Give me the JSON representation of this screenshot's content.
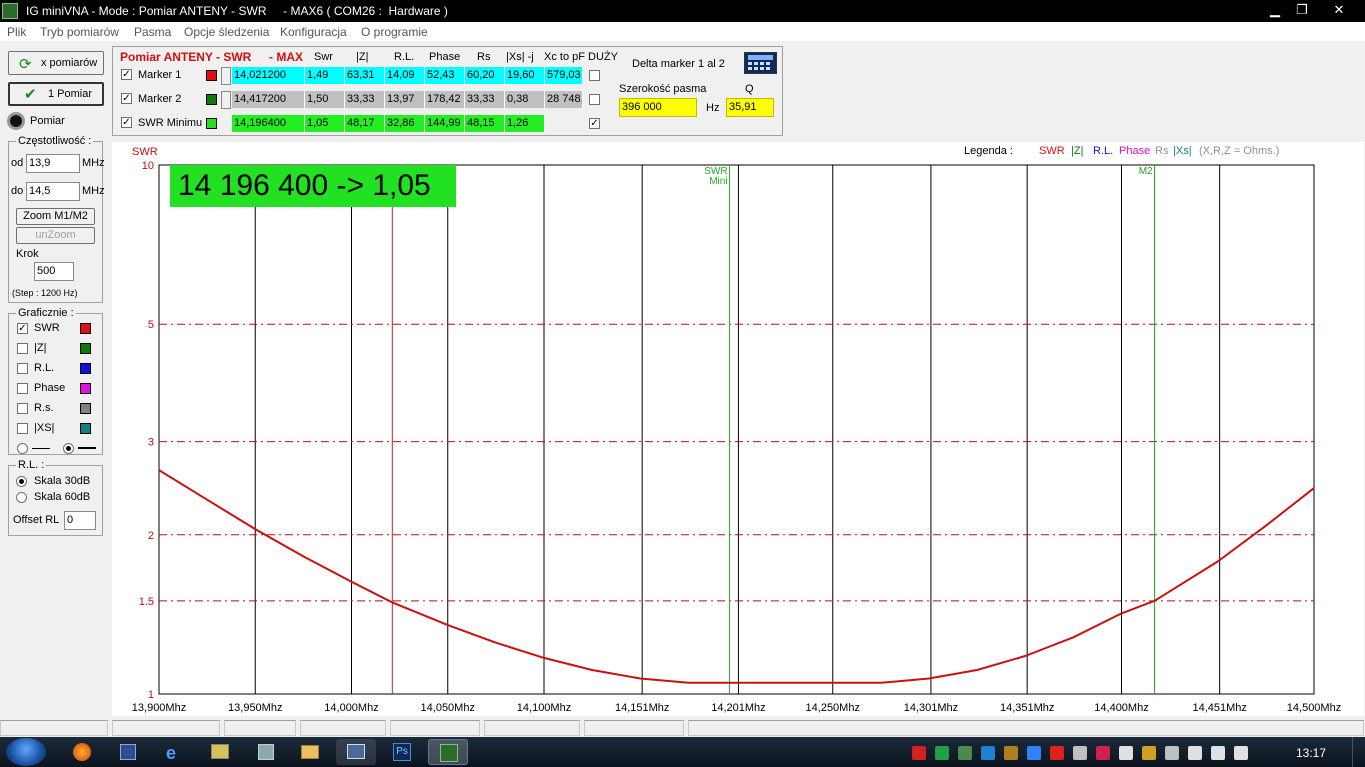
{
  "window": {
    "title": "IG miniVNA - Mode : Pomiar ANTENY - SWR     - MAX6 ( COM26 :  Hardware )",
    "minimize": "▁",
    "maximize": "❐",
    "close": "✕"
  },
  "menu": [
    "Plik",
    "Tryb pomiarów",
    "Pasma",
    "Opcje śledzenia",
    "Konfiguracja",
    "O programie"
  ],
  "left": {
    "x_pomiarow": "x pomiarów",
    "one_pomiar": "1 Pomiar",
    "pomiar": "Pomiar",
    "freq_group": "Częstotliwość :",
    "od_label": "od",
    "od_value": "13,9",
    "do_label": "do",
    "do_value": "14,5",
    "mhz": "MHz",
    "zoom": "Zoom M1/M2",
    "unzoom": "unZoom",
    "krok_label": "Krok",
    "krok_value": "500",
    "step": "(Step : 1200 Hz)",
    "graf_group": "Graficznie :",
    "graf_items": [
      {
        "label": "SWR",
        "checked": "✓",
        "color": "#e01010"
      },
      {
        "label": "|Z|",
        "checked": "",
        "color": "#0a7a0a"
      },
      {
        "label": "R.L.",
        "checked": "",
        "color": "#1010e0"
      },
      {
        "label": "Phase",
        "checked": "",
        "color": "#e010e0"
      },
      {
        "label": "R.s.",
        "checked": "",
        "color": "#808080"
      },
      {
        "label": "|XS|",
        "checked": "",
        "color": "#108080"
      }
    ],
    "rl_group": "R.L. :",
    "skala30": "Skala 30dB",
    "skala60": "Skala 60dB",
    "offset_label": "Offset RL",
    "offset_value": "0"
  },
  "markers": {
    "title_left": "Pomiar ANTENY - SWR",
    "title_right": "- MAX",
    "headers": [
      "Swr",
      "|Z|",
      "R.L.",
      "Phase",
      "Rs",
      "|Xs| -j",
      "Xc to pF",
      "DUŻY"
    ],
    "rows": [
      {
        "label": "Marker 1",
        "check": "✓",
        "color": "#e01010",
        "freq": "14,021200",
        "swr": "1,49",
        "z": "63,31",
        "rl": "14,09",
        "phase": "52,43",
        "rs": "60,20",
        "xs": "19,60",
        "xc": "579,03",
        "duzy": ""
      },
      {
        "label": "Marker 2",
        "check": "✓",
        "color": "#0a7a0a",
        "freq": "14,417200",
        "swr": "1,50",
        "z": "33,33",
        "rl": "13,97",
        "phase": "178,42",
        "rs": "33,33",
        "xs": "0,38",
        "xc": "28 748,",
        "duzy": ""
      },
      {
        "label": "SWR Minimu",
        "check": "✓",
        "color": "#22dd22",
        "freq": "14,196400",
        "swr": "1,05",
        "z": "48,17",
        "rl": "32,86",
        "phase": "144,99",
        "rs": "48,15",
        "xs": "1,26",
        "xc": "",
        "duzy": "✓"
      }
    ],
    "delta_label": "Delta marker 1 al 2",
    "bandwidth_label": "Szerokość pasma",
    "q_label": "Q",
    "bandwidth_value": "396 000",
    "hz": "Hz",
    "q_value": "35,91"
  },
  "chart_data": {
    "type": "line",
    "title": "SWR",
    "big_readout": "14 196 400 -> 1,05",
    "legend_label": "Legenda :",
    "legend_items": [
      {
        "name": "SWR",
        "color": "#e01010"
      },
      {
        "name": "|Z|",
        "color": "#0a7a0a"
      },
      {
        "name": "R.L.",
        "color": "#1010c0"
      },
      {
        "name": "Phase",
        "color": "#d010d0"
      },
      {
        "name": "Rs",
        "color": "#909090"
      },
      {
        "name": "|Xs|",
        "color": "#108080"
      },
      {
        "name": "(X,R,Z = Ohms.)",
        "color": "#909090"
      }
    ],
    "x_range": [
      13.9,
      14.5
    ],
    "y_scale": "log",
    "ylim": [
      1,
      10
    ],
    "y_ticks": [
      {
        "value": 10,
        "label": "10"
      },
      {
        "value": 5,
        "label": "5"
      },
      {
        "value": 3,
        "label": "3"
      },
      {
        "value": 2,
        "label": "2"
      },
      {
        "value": 1.5,
        "label": "1.5"
      },
      {
        "value": 1,
        "label": "1"
      }
    ],
    "x_ticks": [
      {
        "value": 13.9,
        "label": "13,900Mhz"
      },
      {
        "value": 13.95,
        "label": "13,950Mhz"
      },
      {
        "value": 14.0,
        "label": "14,000Mhz"
      },
      {
        "value": 14.05,
        "label": "14,050Mhz"
      },
      {
        "value": 14.1,
        "label": "14,100Mhz"
      },
      {
        "value": 14.151,
        "label": "14,151Mhz"
      },
      {
        "value": 14.201,
        "label": "14,201Mhz"
      },
      {
        "value": 14.25,
        "label": "14,250Mhz"
      },
      {
        "value": 14.301,
        "label": "14,301Mhz"
      },
      {
        "value": 14.351,
        "label": "14,351Mhz"
      },
      {
        "value": 14.4,
        "label": "14,400Mhz"
      },
      {
        "value": 14.451,
        "label": "14,451Mhz"
      },
      {
        "value": 14.5,
        "label": "14,500Mhz"
      }
    ],
    "markers": [
      {
        "name": "M1",
        "x": 14.0212,
        "color": "#cc2020",
        "label": "M1"
      },
      {
        "name": "SWR Mini",
        "x": 14.1964,
        "color": "#20b020",
        "label": "SWR Mini"
      },
      {
        "name": "M2",
        "x": 14.4172,
        "color": "#20a020",
        "label": "M2"
      }
    ],
    "series": [
      {
        "name": "SWR",
        "color": "#cc1010",
        "x": [
          13.9,
          13.925,
          13.95,
          13.975,
          14.0,
          14.0212,
          14.05,
          14.075,
          14.1,
          14.125,
          14.15,
          14.175,
          14.1964,
          14.225,
          14.25,
          14.275,
          14.3,
          14.325,
          14.35,
          14.375,
          14.4,
          14.4172,
          14.45,
          14.475,
          14.5
        ],
        "y": [
          2.65,
          2.33,
          2.05,
          1.82,
          1.63,
          1.49,
          1.35,
          1.25,
          1.17,
          1.11,
          1.07,
          1.05,
          1.05,
          1.05,
          1.05,
          1.05,
          1.07,
          1.11,
          1.18,
          1.28,
          1.42,
          1.5,
          1.78,
          2.08,
          2.45
        ]
      }
    ]
  },
  "statusbar": {
    "panels": [
      "",
      "",
      "",
      "",
      "",
      "",
      "",
      ""
    ]
  },
  "taskbar": {
    "clock": "13:17"
  }
}
